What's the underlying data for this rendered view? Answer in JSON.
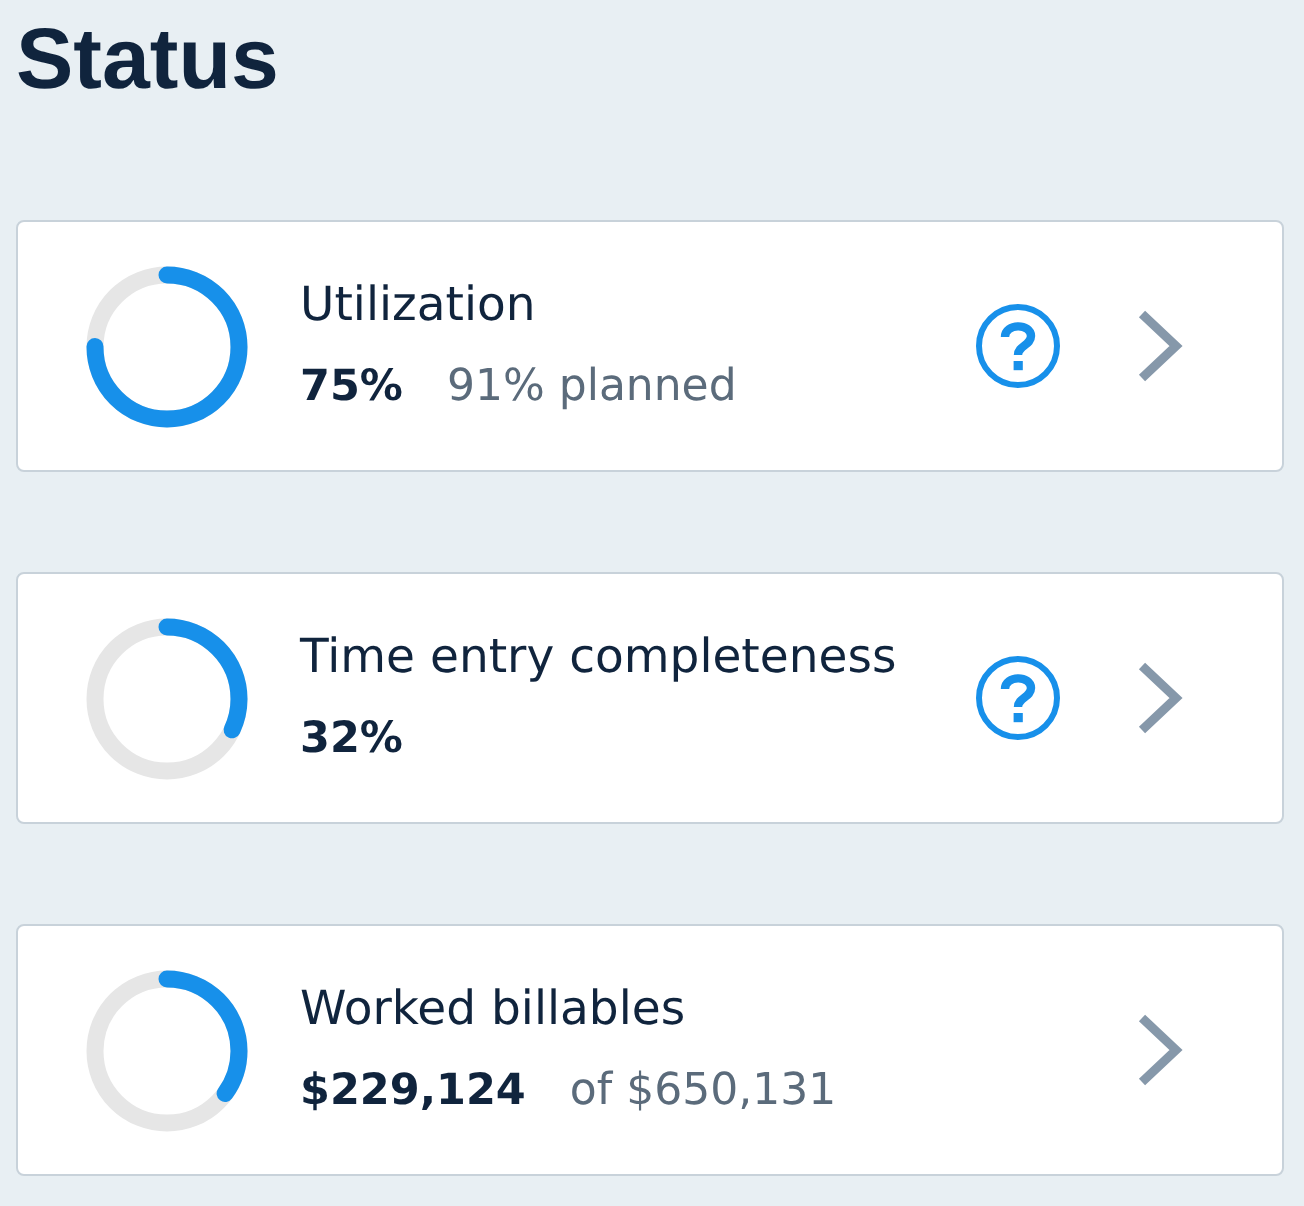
{
  "page": {
    "title": "Status"
  },
  "cards": [
    {
      "title": "Utilization",
      "value": "75%",
      "detail": "91% planned",
      "level": 0.75,
      "help": true
    },
    {
      "title": "Time entry completeness",
      "value": "32%",
      "level": 0.32,
      "help": true
    },
    {
      "title": "Worked billables",
      "value": "$229,124",
      "detail": "of $650,131",
      "level": 0.35,
      "help": false
    }
  ]
}
